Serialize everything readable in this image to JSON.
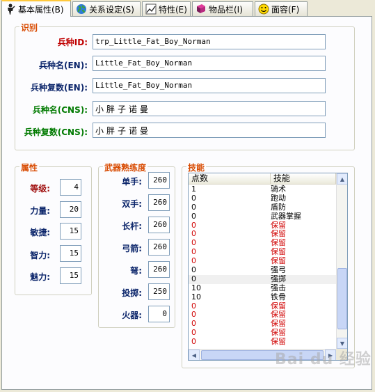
{
  "tabs": [
    {
      "label": "基本属性(B)",
      "icon": "person-icon"
    },
    {
      "label": "关系设定(S)",
      "icon": "globe-icon"
    },
    {
      "label": "特性(E)",
      "icon": "chart-icon"
    },
    {
      "label": "物品栏(I)",
      "icon": "book-icon"
    },
    {
      "label": "面容(F)",
      "icon": "smiley-icon"
    }
  ],
  "identify": {
    "title": "识别",
    "id_label": "兵种ID:",
    "id_value": "trp_Little_Fat_Boy_Norman",
    "name_en_label": "兵种名(EN):",
    "name_en_value": "Little_Fat_Boy_Norman",
    "plural_en_label": "兵种复数(EN):",
    "plural_en_value": "Little_Fat_Boy_Norman",
    "name_cns_label": "兵种名(CNS):",
    "name_cns_value": "小胖子诺曼",
    "plural_cns_label": "兵种复数(CNS):",
    "plural_cns_value": "小胖子诺曼"
  },
  "attributes": {
    "title": "属性",
    "items": [
      {
        "label": "等级:",
        "value": "4"
      },
      {
        "label": "力量:",
        "value": "20"
      },
      {
        "label": "敏捷:",
        "value": "15"
      },
      {
        "label": "智力:",
        "value": "15"
      },
      {
        "label": "魅力:",
        "value": "15"
      }
    ]
  },
  "weapons": {
    "title": "武器熟练度",
    "items": [
      {
        "label": "单手:",
        "value": "260"
      },
      {
        "label": "双手:",
        "value": "260"
      },
      {
        "label": "长杆:",
        "value": "260"
      },
      {
        "label": "弓箭:",
        "value": "260"
      },
      {
        "label": "弩:",
        "value": "260"
      },
      {
        "label": "投掷:",
        "value": "250"
      },
      {
        "label": "火器:",
        "value": "0"
      }
    ]
  },
  "skills": {
    "title": "技能",
    "col_points": "点数",
    "col_skill": "技能",
    "rows": [
      {
        "points": "1",
        "name": "骑术"
      },
      {
        "points": "0",
        "name": "跑动"
      },
      {
        "points": "0",
        "name": "盾防"
      },
      {
        "points": "0",
        "name": "武器掌握"
      },
      {
        "points": "0",
        "name": "保留"
      },
      {
        "points": "0",
        "name": "保留"
      },
      {
        "points": "0",
        "name": "保留"
      },
      {
        "points": "0",
        "name": "保留"
      },
      {
        "points": "0",
        "name": "保留"
      },
      {
        "points": "0",
        "name": "强弓"
      },
      {
        "points": "0",
        "name": "强掷"
      },
      {
        "points": "10",
        "name": "强击"
      },
      {
        "points": "10",
        "name": "铁骨"
      },
      {
        "points": "0",
        "name": "保留"
      },
      {
        "points": "0",
        "name": "保留"
      },
      {
        "points": "0",
        "name": "保留"
      },
      {
        "points": "0",
        "name": "保留"
      },
      {
        "points": "0",
        "name": "保留"
      }
    ]
  },
  "watermark": "Bai du 经验",
  "colors": {
    "legend": "#d84a00",
    "reserved": "#d00000",
    "tab_highlight": "#ffc83c"
  }
}
